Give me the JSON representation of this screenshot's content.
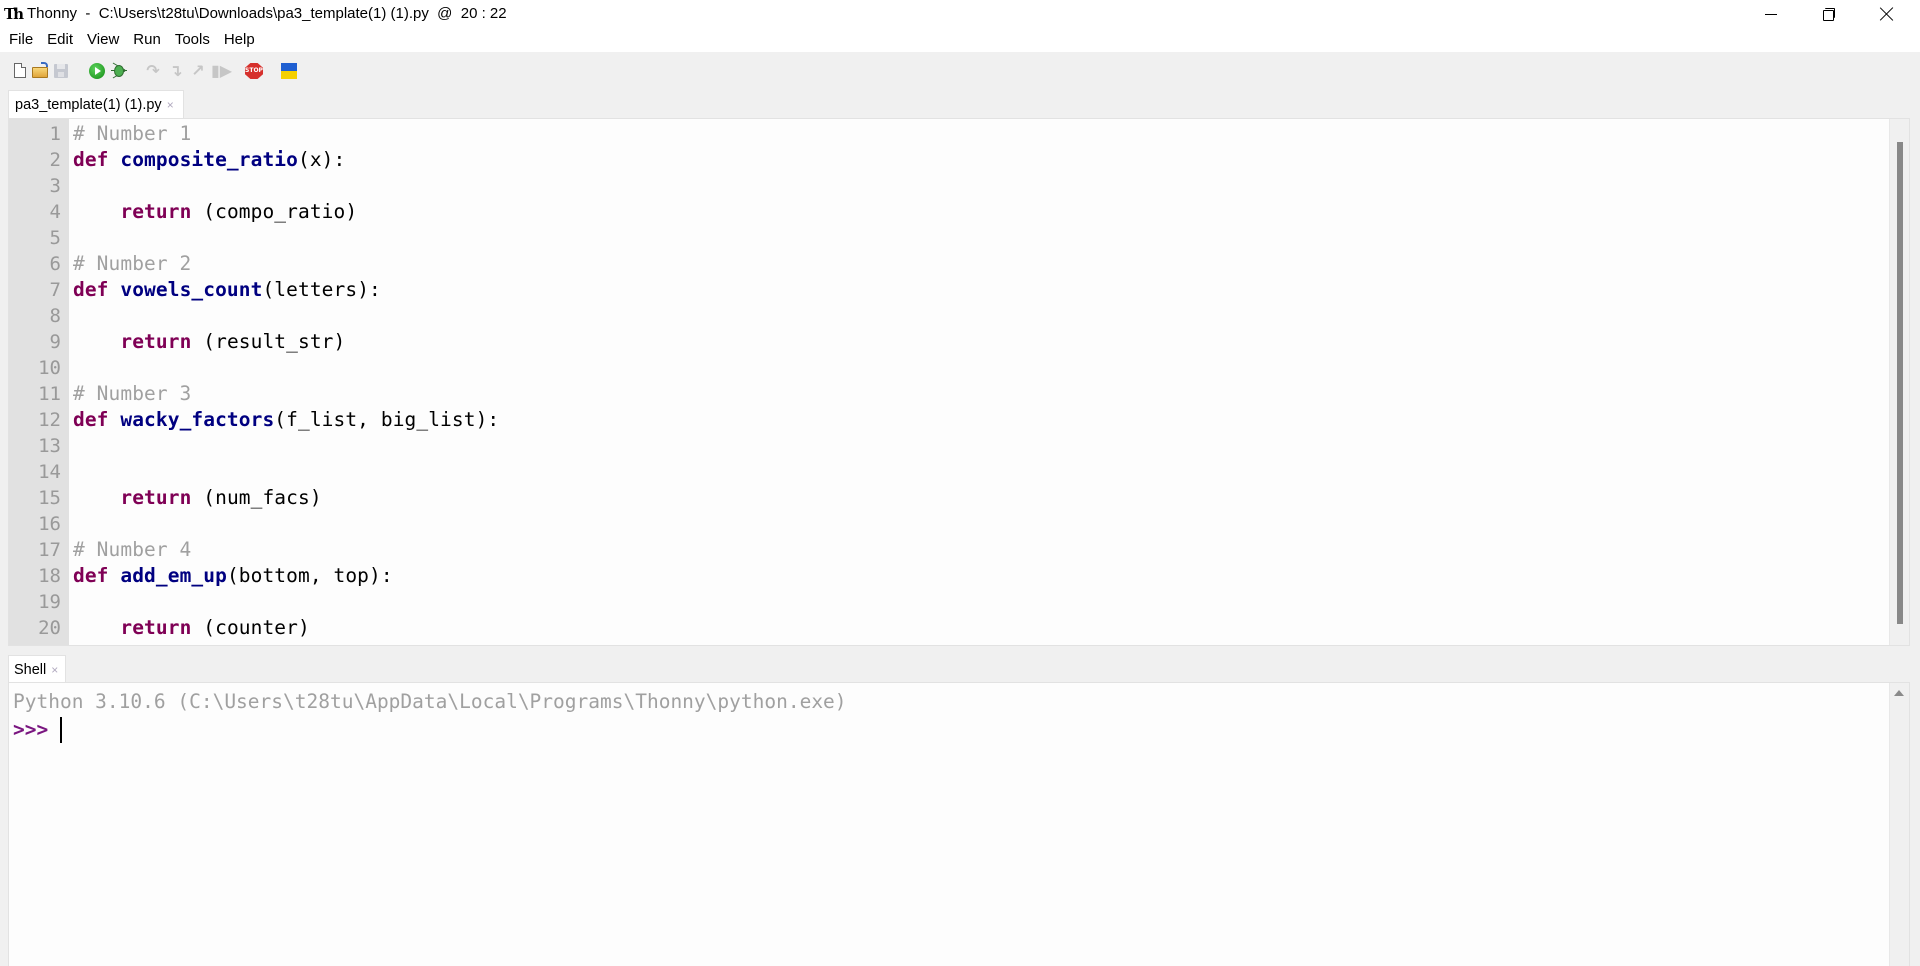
{
  "window": {
    "app_name": "Thonny",
    "title": "Thonny  -  C:\\Users\\t28tu\\Downloads\\pa3_template(1) (1).py  @  20 : 22",
    "logo_text": "Th",
    "controls": {
      "minimize": "minimize-icon",
      "maximize": "restore-icon",
      "close": "close-icon"
    }
  },
  "menu": {
    "items": [
      "File",
      "Edit",
      "View",
      "Run",
      "Tools",
      "Help"
    ]
  },
  "toolbar": {
    "items": [
      {
        "name": "new-file",
        "icon": "new-file-icon",
        "enabled": true
      },
      {
        "name": "open-file",
        "icon": "open-folder-icon",
        "enabled": true
      },
      {
        "name": "save-file",
        "icon": "save-icon",
        "enabled": false
      },
      {
        "name": "run",
        "icon": "run-icon",
        "enabled": true
      },
      {
        "name": "debug",
        "icon": "bug-icon",
        "enabled": true
      },
      {
        "name": "step-over",
        "icon": "step-over-icon",
        "enabled": false
      },
      {
        "name": "step-into",
        "icon": "step-into-icon",
        "enabled": false
      },
      {
        "name": "step-out",
        "icon": "step-out-icon",
        "enabled": false
      },
      {
        "name": "resume",
        "icon": "resume-icon",
        "enabled": false
      },
      {
        "name": "stop",
        "icon": "stop-icon",
        "label": "STOP",
        "enabled": true
      },
      {
        "name": "support-ukraine",
        "icon": "ukraine-flag-icon",
        "enabled": true
      }
    ],
    "stop_label": "STOP"
  },
  "editor": {
    "tab": {
      "label": "pa3_template(1) (1).py",
      "close": "×"
    },
    "lines": [
      {
        "no": "1",
        "tokens": [
          {
            "t": "# Number 1",
            "c": "comment"
          }
        ]
      },
      {
        "no": "2",
        "tokens": [
          {
            "t": "def",
            "c": "kw"
          },
          {
            "t": " ",
            "c": "plain"
          },
          {
            "t": "composite_ratio",
            "c": "fn"
          },
          {
            "t": "(x):",
            "c": "plain"
          }
        ]
      },
      {
        "no": "3",
        "tokens": []
      },
      {
        "no": "4",
        "tokens": [
          {
            "t": "    ",
            "c": "plain"
          },
          {
            "t": "return",
            "c": "kw"
          },
          {
            "t": " (compo_ratio)",
            "c": "plain"
          }
        ]
      },
      {
        "no": "5",
        "tokens": []
      },
      {
        "no": "6",
        "tokens": [
          {
            "t": "# Number 2",
            "c": "comment"
          }
        ]
      },
      {
        "no": "7",
        "tokens": [
          {
            "t": "def",
            "c": "kw"
          },
          {
            "t": " ",
            "c": "plain"
          },
          {
            "t": "vowels_count",
            "c": "fn"
          },
          {
            "t": "(letters):",
            "c": "plain"
          }
        ]
      },
      {
        "no": "8",
        "tokens": []
      },
      {
        "no": "9",
        "tokens": [
          {
            "t": "    ",
            "c": "plain"
          },
          {
            "t": "return",
            "c": "kw"
          },
          {
            "t": " (result_str)",
            "c": "plain"
          }
        ]
      },
      {
        "no": "10",
        "tokens": []
      },
      {
        "no": "11",
        "tokens": [
          {
            "t": "# Number 3",
            "c": "comment"
          }
        ]
      },
      {
        "no": "12",
        "tokens": [
          {
            "t": "def",
            "c": "kw"
          },
          {
            "t": " ",
            "c": "plain"
          },
          {
            "t": "wacky_factors",
            "c": "fn"
          },
          {
            "t": "(f_list, big_list):",
            "c": "plain"
          }
        ]
      },
      {
        "no": "13",
        "tokens": []
      },
      {
        "no": "14",
        "tokens": []
      },
      {
        "no": "15",
        "tokens": [
          {
            "t": "    ",
            "c": "plain"
          },
          {
            "t": "return",
            "c": "kw"
          },
          {
            "t": " (num_facs)",
            "c": "plain"
          }
        ]
      },
      {
        "no": "16",
        "tokens": []
      },
      {
        "no": "17",
        "tokens": [
          {
            "t": "# Number 4",
            "c": "comment"
          }
        ]
      },
      {
        "no": "18",
        "tokens": [
          {
            "t": "def",
            "c": "kw"
          },
          {
            "t": " ",
            "c": "plain"
          },
          {
            "t": "add_em_up",
            "c": "fn"
          },
          {
            "t": "(bottom, top):",
            "c": "plain"
          }
        ]
      },
      {
        "no": "19",
        "tokens": []
      },
      {
        "no": "20",
        "tokens": [
          {
            "t": "    ",
            "c": "plain"
          },
          {
            "t": "return",
            "c": "kw"
          },
          {
            "t": " (counter)",
            "c": "plain"
          }
        ]
      }
    ]
  },
  "shell": {
    "tab": {
      "label": "Shell",
      "close": "×"
    },
    "banner": "Python 3.10.6 (C:\\Users\\t28tu\\AppData\\Local\\Programs\\Thonny\\python.exe)",
    "prompt": ">>>",
    "input": ""
  },
  "colors": {
    "keyword": "#7f0055",
    "function_name": "#000080",
    "comment": "#a0a0a0",
    "prompt": "#7a1680",
    "gutter_bg": "#e1e1e1",
    "line_number": "#999999",
    "chrome_bg": "#f0f0f0"
  }
}
